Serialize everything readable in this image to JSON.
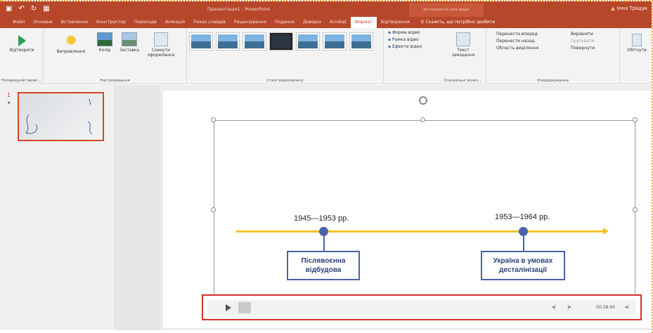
{
  "titlebar": {
    "presentation_title": "Презентація1 - PowerPoint",
    "tools_tab": "Інструменти для відео",
    "user": "Інна Тріщук",
    "quick_access": [
      "save-icon",
      "undo-icon",
      "redo-icon",
      "slideshow-icon"
    ]
  },
  "tabs": [
    "Файл",
    "Основне",
    "Вставлення",
    "Конструктор",
    "Переходи",
    "Анімація",
    "Показ слайдів",
    "Рецензування",
    "Подання",
    "Довідка",
    "Acrobat",
    "Формат",
    "Відтворення"
  ],
  "active_tab": "Формат",
  "tell_me": "Скажіть, що потрібно зробити",
  "ribbon": {
    "preview": {
      "button": "Відтворити",
      "group": "Попередній перег..."
    },
    "adjust": {
      "buttons": [
        "Виправлення",
        "Колір",
        "Заставка",
        "Скинути оформлення"
      ],
      "group": "Настроювання"
    },
    "styles": {
      "group": "Стилі відеозапису"
    },
    "video_options": [
      "Форма відео",
      "Рамка відео",
      "Ефекти відео"
    ],
    "accessibility": {
      "button": "Текст заміщення",
      "group": "Спеціальні можл..."
    },
    "arrange": {
      "items": [
        "Перенести вперед",
        "Перенести назад",
        "Область виділення",
        "Вирівняти",
        "Групувати",
        "Повернути"
      ],
      "group": "Упорядкування"
    },
    "crop": "Обітнути"
  },
  "slide_panel": {
    "slide_number": "1",
    "star": "★"
  },
  "slide": {
    "events": [
      {
        "date": "1945—1953 рр.",
        "label_line1": "Післявоєнна",
        "label_line2": "відбудова"
      },
      {
        "date": "1953—1964 рр.",
        "label_line1": "Україна в умовах",
        "label_line2": "десталінізації"
      }
    ]
  },
  "media_controls": {
    "time": "00:28.60",
    "skip_back": "◂|",
    "skip_fwd": "|▸",
    "volume": "◂)"
  },
  "colors": {
    "accent": "#b7472a",
    "timeline": "#f4c12e",
    "node": "#4a62a8",
    "highlight": "#d32f2f"
  }
}
